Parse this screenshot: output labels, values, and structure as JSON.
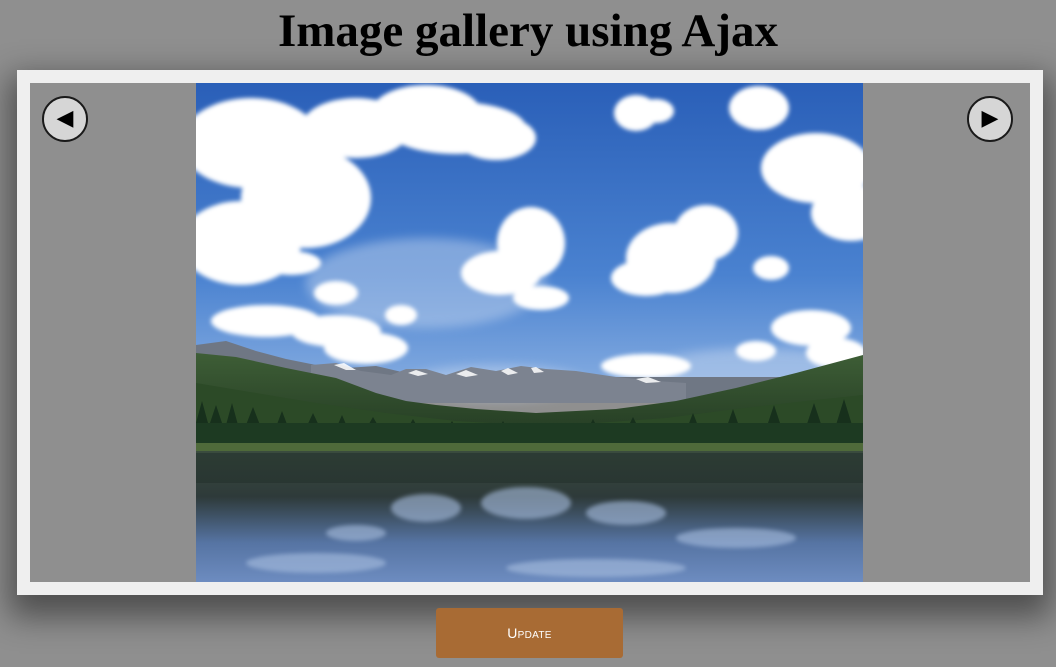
{
  "page": {
    "title": "Image gallery using Ajax"
  },
  "gallery": {
    "prev_glyph": "◀",
    "next_glyph": "▶",
    "prev_icon": "left-triangle-icon",
    "next_icon": "right-triangle-icon",
    "photo_subject": "mountain lake landscape with clouds"
  },
  "actions": {
    "update_label": "Update"
  },
  "colors": {
    "background": "#8f8f8f",
    "frame": "#efefef",
    "button": "#a86b34",
    "sky": "#3f74c9"
  }
}
